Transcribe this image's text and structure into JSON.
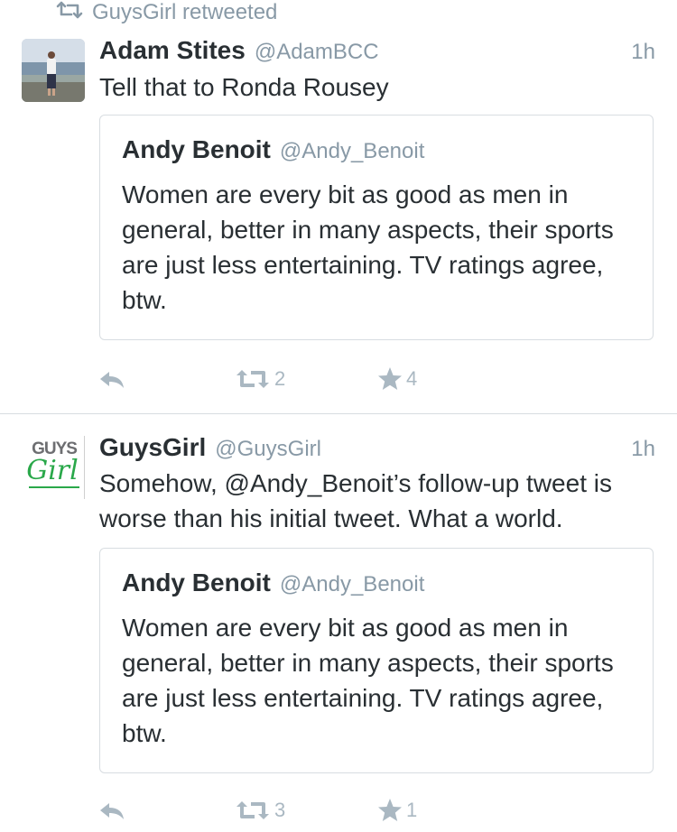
{
  "retweet_context": {
    "text": "GuysGirl retweeted"
  },
  "tweets": [
    {
      "author_name": "Adam Stites",
      "author_handle": "@AdamBCC",
      "time": "1h",
      "text": "Tell that to Ronda Rousey",
      "quote": {
        "author_name": "Andy Benoit",
        "author_handle": "@Andy_Benoit",
        "text": "Women are every bit as good as men in general, better in many aspects, their sports are just less entertaining. TV ratings agree, btw."
      },
      "retweet_count": "2",
      "favorite_count": "4"
    },
    {
      "author_name": "GuysGirl",
      "author_handle": "@GuysGirl",
      "time": "1h",
      "text": "Somehow, @Andy_Benoit’s follow-up tweet is worse than his initial tweet. What a world.",
      "avatar_logo": {
        "top": "GUYS",
        "bottom": "Girl"
      },
      "quote": {
        "author_name": "Andy Benoit",
        "author_handle": "@Andy_Benoit",
        "text": "Women are every bit as good as men in general, better in many aspects, their sports are just less entertaining. TV ratings agree, btw."
      },
      "retweet_count": "3",
      "favorite_count": "1"
    }
  ],
  "icons": {
    "retweet": "retweet-icon",
    "reply": "reply-icon",
    "favorite": "star-icon"
  },
  "colors": {
    "text": "#292f33",
    "secondary": "#8899a6",
    "action": "#aab8c2",
    "border": "#d8dde1",
    "logo_green": "#2aa84a",
    "logo_gray": "#6d6e71"
  }
}
